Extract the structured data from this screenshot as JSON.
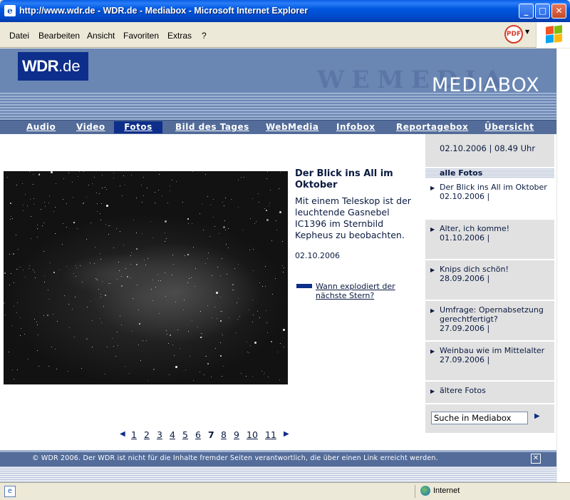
{
  "window": {
    "title": "http://www.wdr.de - WDR.de - Mediabox - Microsoft Internet Explorer",
    "minimize": "_",
    "maximize": "□",
    "close": "✕"
  },
  "menu": [
    "Datei",
    "Bearbeiten",
    "Ansicht",
    "Favoriten",
    "Extras",
    "?"
  ],
  "header": {
    "logo_bold": "WDR",
    "logo_suffix": ".de",
    "ghost_text": "WEMEDIA",
    "title": "MEDIABOX"
  },
  "nav": [
    "Audio",
    "Video",
    "Fotos",
    "Bild des Tages",
    "WebMedia",
    "Infobox",
    "Reportagebox",
    "Übersicht"
  ],
  "nav_active": "Fotos",
  "article": {
    "title": "Der Blick ins All im Oktober",
    "text": "Mit einem Teleskop ist der leuchtende Gasnebel IC1396 im Sternbild Kepheus zu beobachten.",
    "date": "02.10.2006",
    "related_link": "Wann explodiert der nächste Stern?"
  },
  "pager": {
    "prev": "◀",
    "next": "▶",
    "pages": [
      "1",
      "2",
      "3",
      "4",
      "5",
      "6",
      "7",
      "8",
      "9",
      "10",
      "11"
    ],
    "current": "7"
  },
  "sidebar": {
    "datetime": "02.10.2006 | 08.49 Uhr",
    "section": "alle Fotos",
    "entries": [
      {
        "title": "Der Blick ins All im Oktober",
        "date": "02.10.2006 |"
      },
      {
        "title": "Alter, ich komme!",
        "date": "01.10.2006 |"
      },
      {
        "title": "Knips dich schön!",
        "date": "28.09.2006 |"
      },
      {
        "title": "Umfrage: Opernabsetzung gerechtfertigt?",
        "date": "27.09.2006 |"
      },
      {
        "title": "Weinbau wie im Mittelalter",
        "date": "27.09.2006 |"
      }
    ],
    "older": "ältere Fotos",
    "search_value": "Suche in Mediabox"
  },
  "footer": {
    "text": "© WDR 2006. Der WDR ist nicht für die Inhalte fremder Seiten verantwortlich, die über einen Link erreicht werden.",
    "close": "✕"
  },
  "status": {
    "zone": "Internet"
  },
  "colors": {
    "brand_dark_blue": "#0d2e8a",
    "banner_blue": "#6a87b4",
    "nav_blue": "#536c99",
    "sidebar_gray": "#e1e1e1"
  }
}
